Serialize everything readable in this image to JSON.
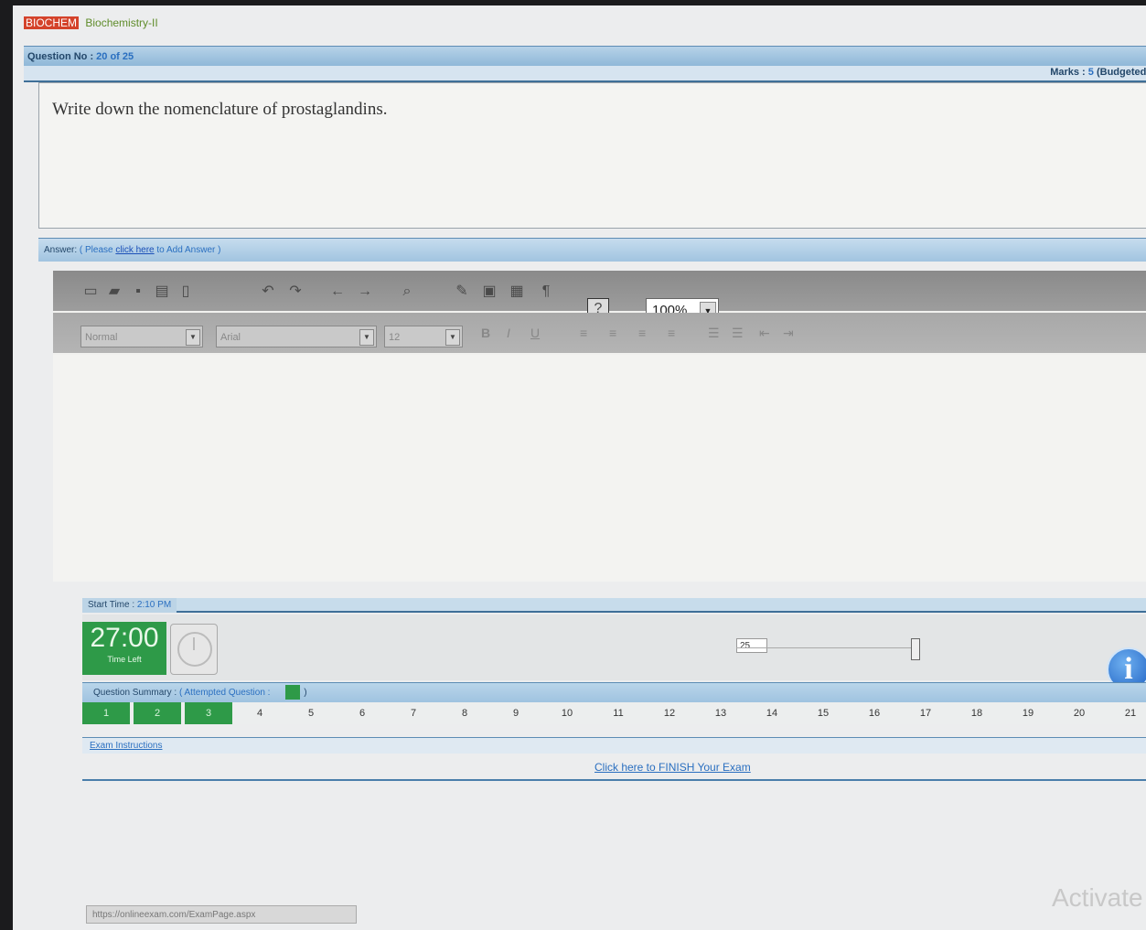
{
  "header": {
    "exam_code": "BIOCHEM",
    "subject": "Biochemistry-II"
  },
  "question_bar": {
    "label": "Question No :",
    "number": "20 of 25",
    "marks_label": "Marks :",
    "marks_value": "5",
    "budgeted": "(Budgeted Ti"
  },
  "question": {
    "text": "Write down the nomenclature of prostaglandins."
  },
  "answer_bar": {
    "label": "Answer:",
    "prefix": "( Please",
    "click_here": "click here",
    "suffix": "to Add Answer )"
  },
  "editor": {
    "zoom": "100%",
    "style_select": "Normal",
    "font_select": "Arial",
    "size_select": "12",
    "toolbar_icons": [
      "new-icon",
      "open-icon",
      "save-icon",
      "print-icon",
      "preview-icon",
      "undo-icon",
      "redo-icon",
      "cut-icon",
      "copy-icon",
      "find-icon",
      "spell-icon",
      "paste-icon",
      "paste-text-icon",
      "paragraph-icon",
      "help-icon"
    ],
    "format_icons": [
      "bold-icon",
      "italic-icon",
      "underline-icon",
      "align-left-icon",
      "align-center-icon",
      "align-right-icon",
      "justify-icon",
      "ordered-list-icon",
      "unordered-list-icon",
      "outdent-icon",
      "indent-icon"
    ]
  },
  "timer": {
    "start_time_label": "Start Time :",
    "start_time_value": "2:10 PM",
    "remaining": "27:00",
    "remaining_label": "Time Left",
    "slider_value": "25"
  },
  "summary": {
    "label": "Question Summary :",
    "attempted_label": "( Attempted Question :",
    "attempted_close": ")",
    "questions": [
      "1",
      "2",
      "3",
      "4",
      "5",
      "6",
      "7",
      "8",
      "9",
      "10",
      "11",
      "12",
      "13",
      "14",
      "15",
      "16",
      "17",
      "18",
      "19",
      "20",
      "21"
    ],
    "attempted": [
      "1",
      "2",
      "3"
    ]
  },
  "instructions_link": "Exam Instructions",
  "finish_link": "Click here to FINISH Your Exam",
  "status_bar": "https://onlineexam.com/ExamPage.aspx",
  "watermark": "Activate",
  "colors": {
    "header_code": "#d4422a",
    "attempted": "#2e9a48",
    "link": "#2a6fc0",
    "bar": "#a1c4e0"
  }
}
